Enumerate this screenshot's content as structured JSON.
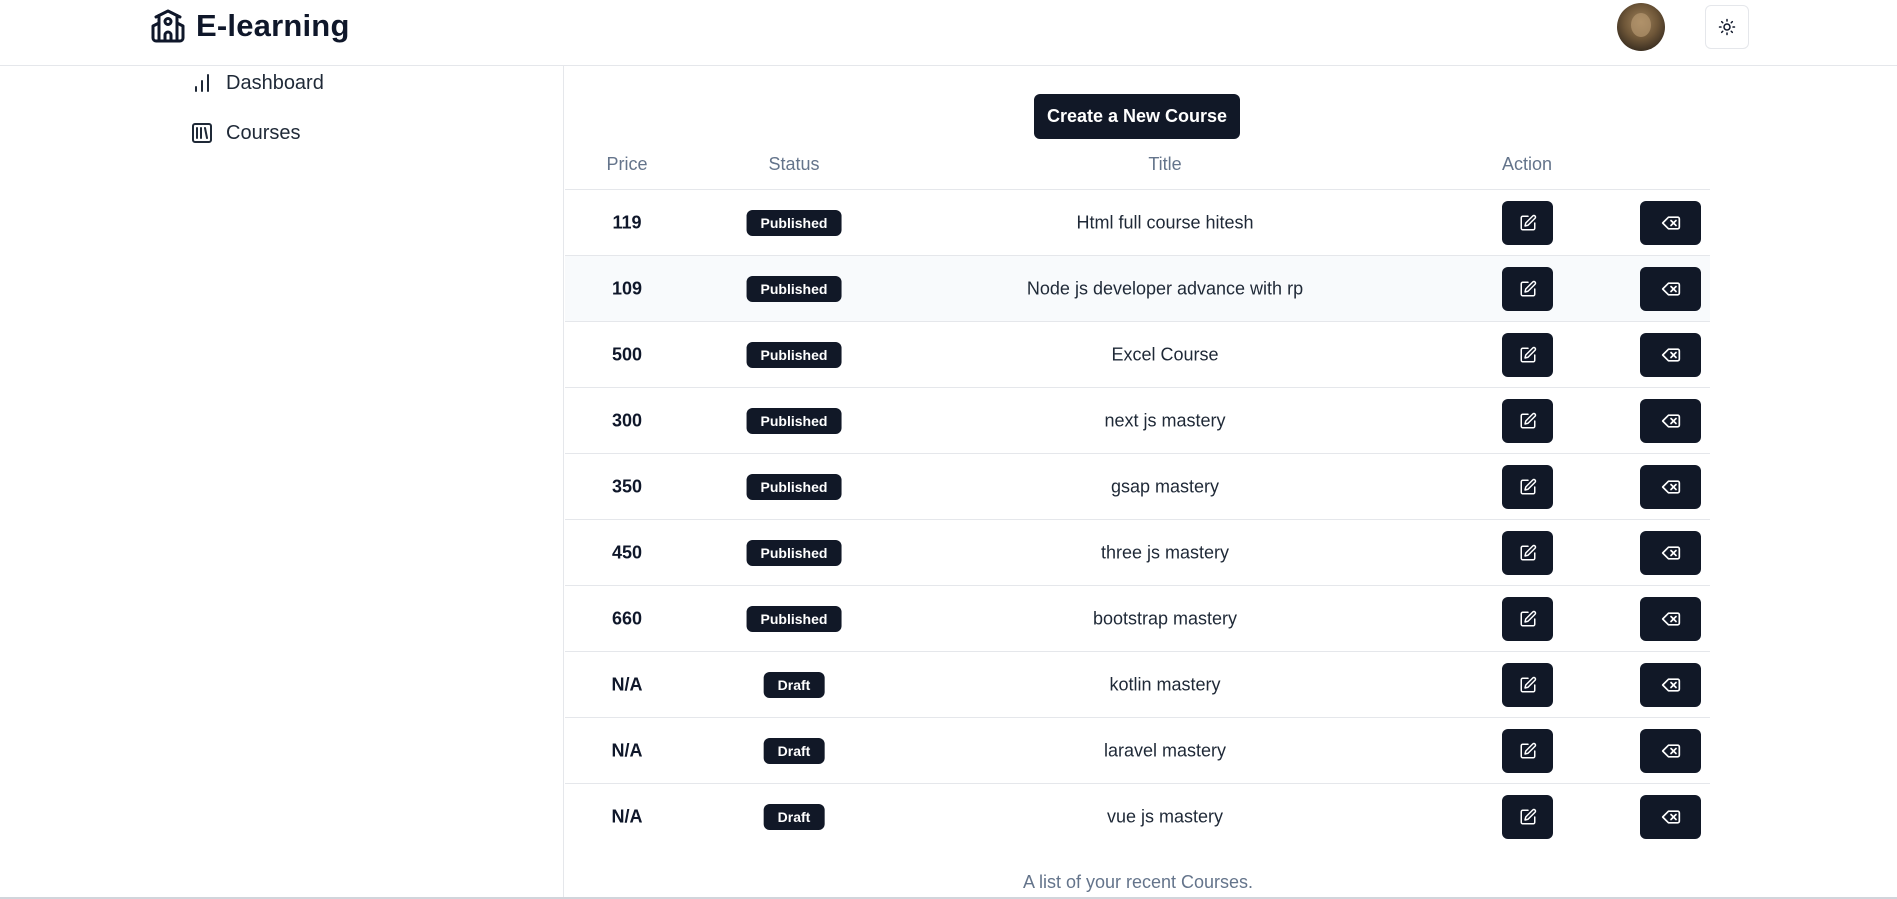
{
  "header": {
    "brand_icon": "school-icon",
    "brand_name": "E-learning",
    "avatar_icon": "user-avatar",
    "theme_icon": "sun-icon"
  },
  "sidebar": {
    "items": [
      {
        "label": "Dashboard",
        "icon": "bar-chart-icon"
      },
      {
        "label": "Courses",
        "icon": "library-icon"
      }
    ]
  },
  "main": {
    "create_button": "Create a New Course",
    "columns": {
      "price": "Price",
      "status": "Status",
      "title": "Title",
      "action": "Action"
    },
    "rows": [
      {
        "price": "119",
        "status": "Published",
        "title": "Html full course hitesh"
      },
      {
        "price": "109",
        "status": "Published",
        "title": "Node js developer advance with rp"
      },
      {
        "price": "500",
        "status": "Published",
        "title": "Excel Course"
      },
      {
        "price": "300",
        "status": "Published",
        "title": "next js mastery"
      },
      {
        "price": "350",
        "status": "Published",
        "title": "gsap mastery"
      },
      {
        "price": "450",
        "status": "Published",
        "title": "three js mastery"
      },
      {
        "price": "660",
        "status": "Published",
        "title": "bootstrap mastery"
      },
      {
        "price": "N/A",
        "status": "Draft",
        "title": "kotlin mastery"
      },
      {
        "price": "N/A",
        "status": "Draft",
        "title": "laravel mastery"
      },
      {
        "price": "N/A",
        "status": "Draft",
        "title": "vue js mastery"
      }
    ],
    "caption": "A list of your recent Courses."
  },
  "colors": {
    "primary": "#111827",
    "muted_text": "#64748b",
    "border": "#e5e7eb",
    "row_alt": "#f8fafc"
  }
}
